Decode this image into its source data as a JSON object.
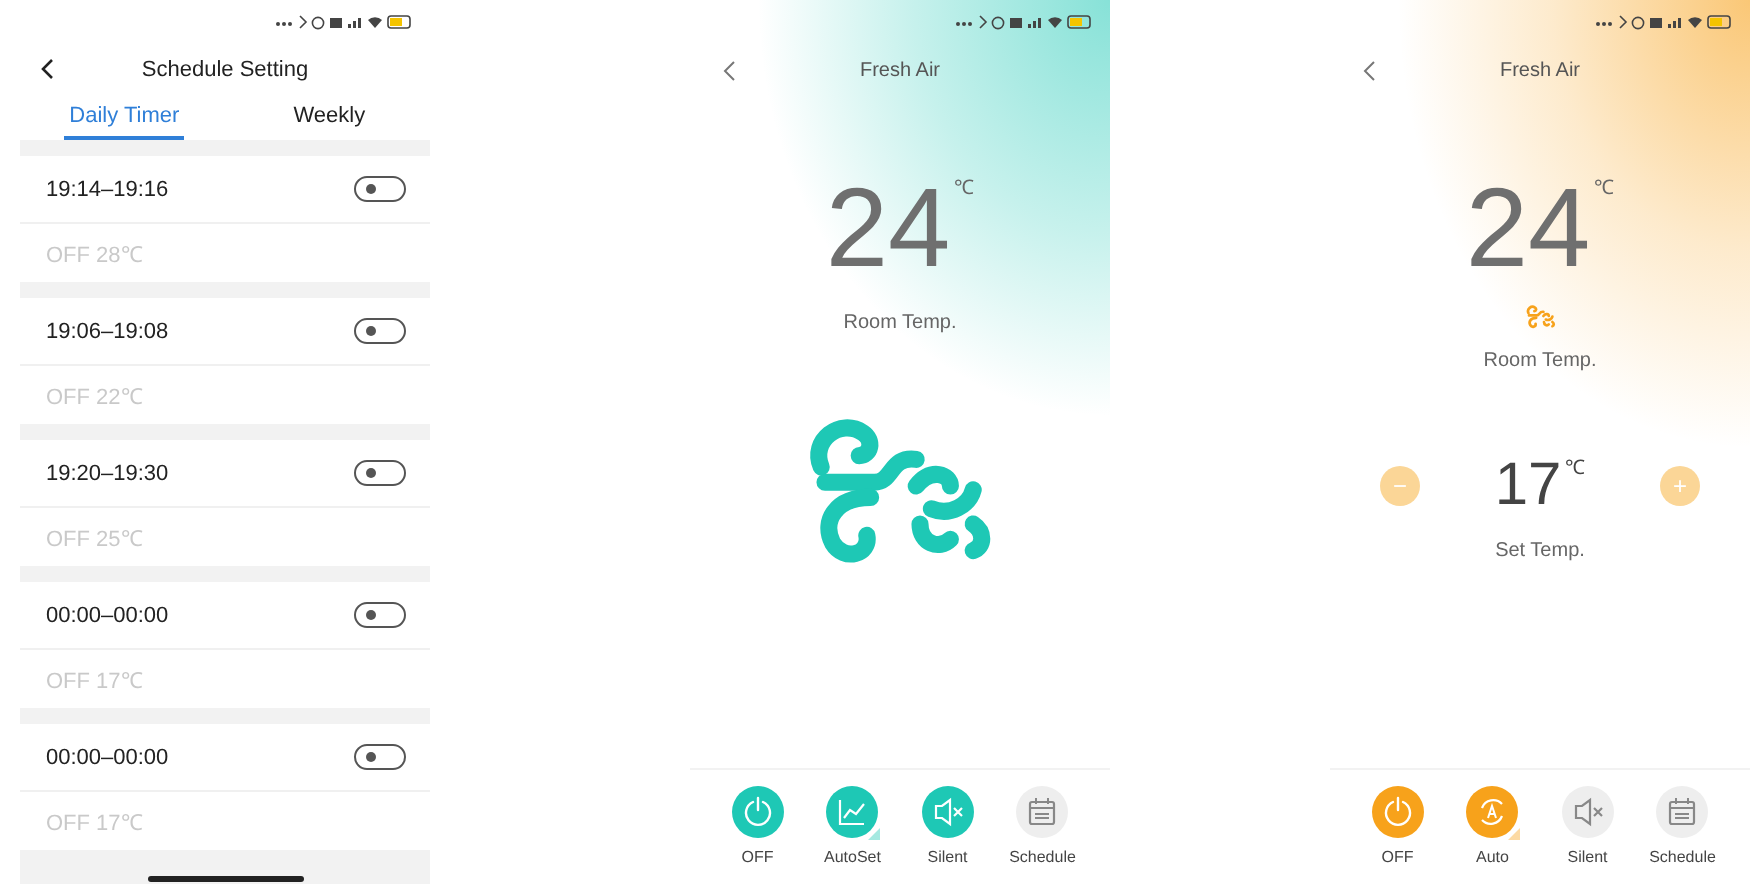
{
  "schedule_screen": {
    "title": "Schedule Setting",
    "tabs": [
      {
        "label": "Daily Timer",
        "selected": true
      },
      {
        "label": "Weekly",
        "selected": false
      }
    ],
    "timers": [
      {
        "time": "19:14–19:16",
        "detail": "OFF 28℃",
        "on": false
      },
      {
        "time": "19:06–19:08",
        "detail": "OFF 22℃",
        "on": false
      },
      {
        "time": "19:20–19:30",
        "detail": "OFF 25℃",
        "on": false
      },
      {
        "time": "00:00–00:00",
        "detail": "OFF 17℃",
        "on": false
      },
      {
        "time": "00:00–00:00",
        "detail": "OFF 17℃",
        "on": false
      }
    ]
  },
  "control_screens": [
    {
      "kind": "fan",
      "color": "#1ec8b5",
      "title": "Fresh Air",
      "room_temp": "24",
      "room_unit": "℃",
      "room_label": "Room Temp.",
      "buttons": [
        {
          "kind": "power",
          "label": "OFF",
          "active": true,
          "expandable": false
        },
        {
          "kind": "chart",
          "label": "AutoSet",
          "active": true,
          "expandable": true
        },
        {
          "kind": "mute",
          "label": "Silent",
          "active": true,
          "expandable": false
        },
        {
          "kind": "calendar",
          "label": "Schedule",
          "active": false,
          "expandable": false
        }
      ]
    },
    {
      "kind": "setpoint",
      "color": "#f7a21b",
      "title": "Fresh Air",
      "room_temp": "24",
      "room_unit": "℃",
      "room_label": "Room Temp.",
      "set_temp": "17",
      "set_unit": "℃",
      "set_label": "Set Temp.",
      "minus": "−",
      "plus": "+",
      "buttons": [
        {
          "kind": "power",
          "label": "OFF",
          "active": true,
          "expandable": false
        },
        {
          "kind": "auto",
          "label": "Auto",
          "active": true,
          "expandable": true
        },
        {
          "kind": "mute",
          "label": "Silent",
          "active": false,
          "expandable": false
        },
        {
          "kind": "calendar",
          "label": "Schedule",
          "active": false,
          "expandable": false
        }
      ]
    }
  ]
}
